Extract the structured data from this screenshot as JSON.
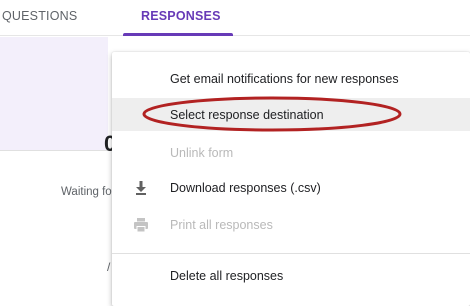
{
  "tabs": {
    "questions": "QUESTIONS",
    "responses": "RESPONSES"
  },
  "background": {
    "waiting_text": "Waiting for responses"
  },
  "menu": {
    "items": [
      {
        "label": "Get email notifications for new responses",
        "icon": "",
        "enabled": true
      },
      {
        "label": "Select response destination",
        "icon": "",
        "enabled": true,
        "highlighted": true,
        "annotated": true
      },
      {
        "label": "Unlink form",
        "icon": "",
        "enabled": false
      },
      {
        "label": "Download responses (.csv)",
        "icon": "download-icon",
        "enabled": true
      },
      {
        "label": "Print all responses",
        "icon": "print-icon",
        "enabled": false
      },
      {
        "label": "Delete all responses",
        "icon": "",
        "enabled": true
      }
    ]
  },
  "colors": {
    "accent": "#673ab7",
    "annotation": "#b22222",
    "highlight": "#eeeeee",
    "disabled_text": "#b9b9b9"
  }
}
